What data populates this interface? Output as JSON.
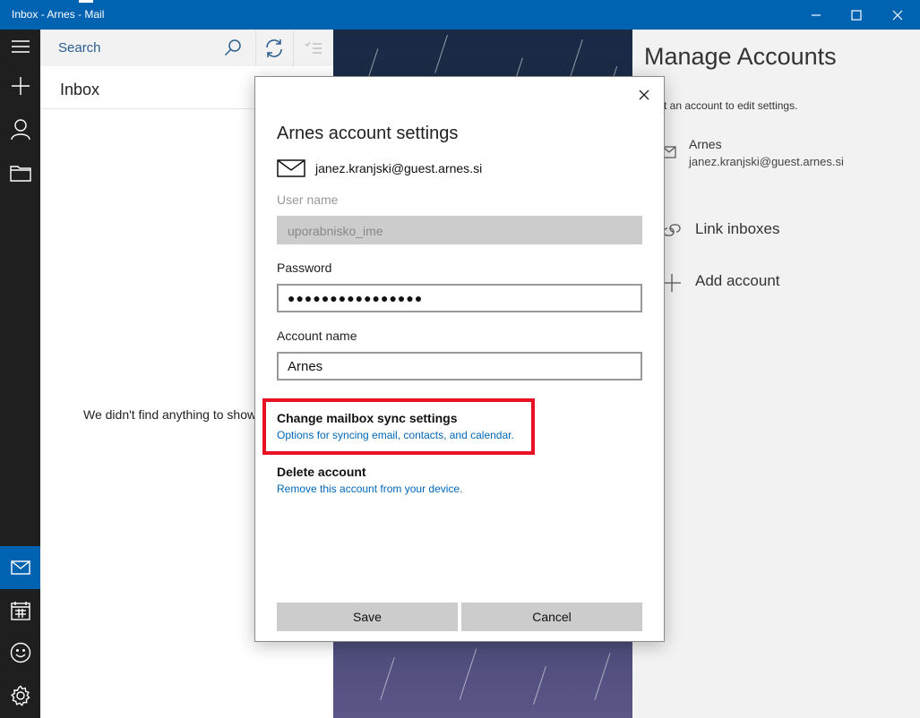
{
  "window": {
    "title": "Inbox - Arnes - Mail"
  },
  "rail": {
    "items": [
      "menu-icon",
      "compose-icon",
      "accounts-icon",
      "folders-icon",
      "mail-icon",
      "calendar-icon",
      "feedback-icon",
      "settings-icon"
    ]
  },
  "list": {
    "search_placeholder": "Search",
    "folder_title": "Inbox",
    "empty_message": "We didn't find anything to show"
  },
  "manage": {
    "title": "Manage Accounts",
    "subtitle": "elect an account to edit settings.",
    "account": {
      "name": "Arnes",
      "email": "janez.kranjski@guest.arnes.si"
    },
    "link_inboxes": "Link inboxes",
    "add_account": "Add account"
  },
  "dialog": {
    "title": "Arnes account settings",
    "email": "janez.kranjski@guest.arnes.si",
    "username_label": "User name",
    "username_value": "uporabnisko_ime",
    "password_label": "Password",
    "password_value": "●●●●●●●●●●●●●●●●",
    "account_name_label": "Account name",
    "account_name_value": "Arnes",
    "sync_title": "Change mailbox sync settings",
    "sync_desc": "Options for syncing email, contacts, and calendar.",
    "delete_title": "Delete account",
    "delete_desc": "Remove this account from your device.",
    "save_label": "Save",
    "cancel_label": "Cancel"
  },
  "colors": {
    "accent": "#0063b1",
    "link": "#0067b8",
    "highlight": "#e81123"
  }
}
